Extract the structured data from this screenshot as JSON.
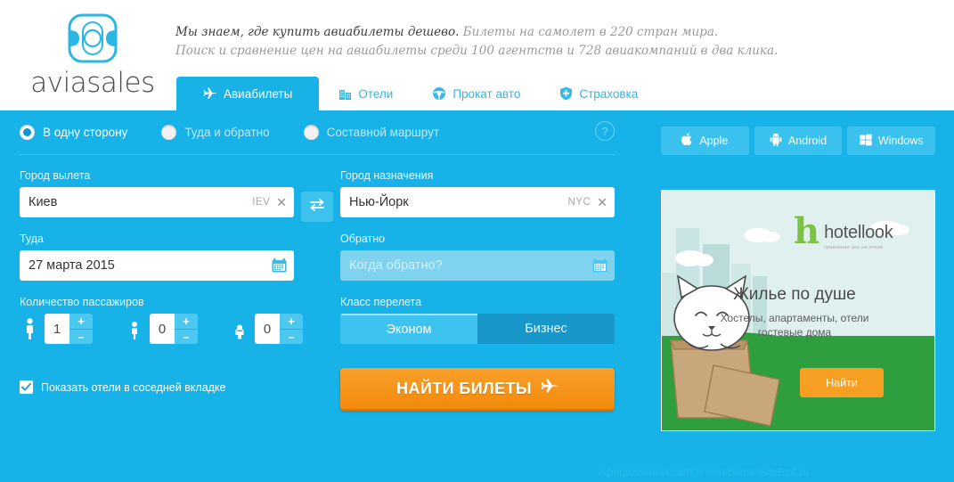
{
  "brand": {
    "name": "aviasales",
    "logo_icon": "aviasales-logo-icon"
  },
  "tagline": {
    "line1_strong": "Мы знаем, где купить авиабилеты дешево.",
    "line1_rest": " Билеты на самолет в 220 стран мира.",
    "line2": "Поиск и сравнение цен на авиабилеты среди 100 агентств и 728 авиакомпаний в два клика."
  },
  "tabs": [
    {
      "label": "Авиабилеты",
      "icon": "airplane-icon",
      "active": true
    },
    {
      "label": "Отели",
      "icon": "building-icon",
      "active": false
    },
    {
      "label": "Прокат авто",
      "icon": "steering-wheel-icon",
      "active": false
    },
    {
      "label": "Страховка",
      "icon": "shield-icon",
      "active": false
    }
  ],
  "trip_type": {
    "options": [
      {
        "label": "В одну сторону",
        "selected": true
      },
      {
        "label": "Туда и обратно",
        "selected": false
      },
      {
        "label": "Составной маршрут",
        "selected": false
      }
    ],
    "help_label": "?"
  },
  "search_form": {
    "origin": {
      "label": "Город вылета",
      "value": "Киев",
      "code": "IEV",
      "clear": "✕"
    },
    "destination": {
      "label": "Город назначения",
      "value": "Нью-Йорк",
      "code": "NYC",
      "clear": "✕"
    },
    "swap_icon": "swap-arrows-icon",
    "depart_date": {
      "label": "Туда",
      "value": "27 марта 2015",
      "icon": "calendar-icon"
    },
    "return_date": {
      "label": "Обратно",
      "value": "",
      "placeholder": "Когда обратно?",
      "icon": "calendar-icon"
    },
    "passengers": {
      "label": "Количество пассажиров",
      "items": [
        {
          "type": "adult",
          "icon": "adult-passenger-icon",
          "count": "1",
          "plus": "+",
          "minus": "–"
        },
        {
          "type": "child",
          "icon": "child-passenger-icon",
          "count": "0",
          "plus": "+",
          "minus": "–"
        },
        {
          "type": "infant",
          "icon": "infant-passenger-icon",
          "count": "0",
          "plus": "+",
          "minus": "–"
        }
      ]
    },
    "flight_class": {
      "label": "Класс перелета",
      "options": [
        {
          "label": "Эконом",
          "selected": true
        },
        {
          "label": "Бизнес",
          "selected": false
        }
      ]
    },
    "hotels_checkbox": {
      "label": "Показать отели в соседней вкладке",
      "checked": true
    },
    "submit": {
      "label": "НАЙТИ БИЛЕТЫ",
      "icon": "airplane-icon"
    }
  },
  "platforms": [
    {
      "label": "Apple",
      "icon": "apple-icon"
    },
    {
      "label": "Android",
      "icon": "android-icon"
    },
    {
      "label": "Windows",
      "icon": "windows-icon"
    }
  ],
  "banner": {
    "logo_letter": "h",
    "logo_name": "hotellook",
    "logo_sub": "сравнение цен на отели",
    "headline": "Жилье по душе",
    "subline1": "Хостелы, апартаменты, отели",
    "subline2": "гостевые дома",
    "button": "Найти"
  },
  "watermark": {
    "text": "официальный сайт в интернете SiteStat.ru"
  },
  "colors": {
    "panel_blue": "#17b3e8",
    "tab_blue": "#18b2e6",
    "accent_orange": "#f79f22",
    "banner_green": "#2e9e3e",
    "logo_green": "#7cc243"
  }
}
